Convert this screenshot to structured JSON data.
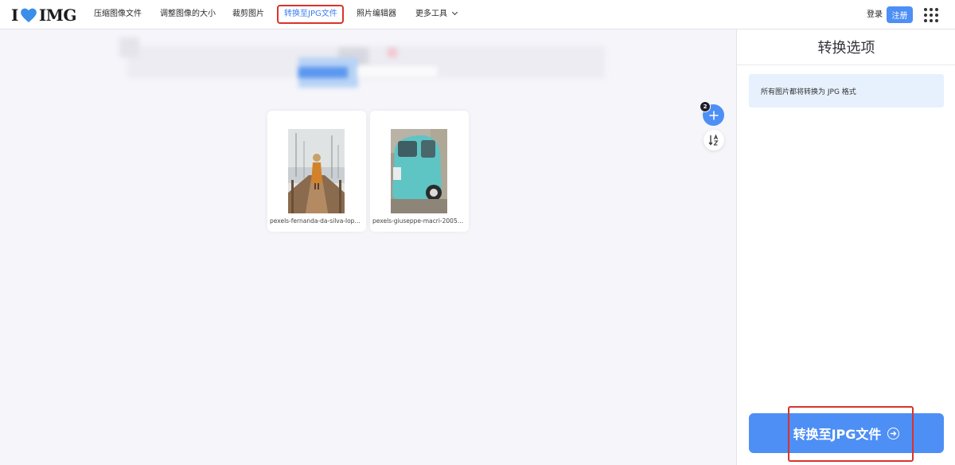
{
  "header": {
    "logo_text_left": "I",
    "logo_text_right": "IMG",
    "nav": [
      {
        "label": "压缩图像文件"
      },
      {
        "label": "调整图像的大小"
      },
      {
        "label": "裁剪图片"
      },
      {
        "label": "转换至JPG文件",
        "active": true
      },
      {
        "label": "照片编辑器"
      },
      {
        "label": "更多工具"
      }
    ],
    "login_label": "登录",
    "signup_label": "注册"
  },
  "files": [
    {
      "name": "pexels-fernanda-da-silva-lopes-..."
    },
    {
      "name": "pexels-giuseppe-macri-2005726..."
    }
  ],
  "file_count": "2",
  "sidebar": {
    "title": "转换选项",
    "info": "所有图片都将转换为 JPG 格式",
    "convert_label": "转换至JPG文件"
  },
  "colors": {
    "accent": "#4d8ff5",
    "highlight_outline": "#d9342b",
    "info_bg": "#e7f1fd"
  },
  "icons": [
    "heart-logo-icon",
    "chevron-down-icon",
    "apps-grid-icon",
    "plus-icon",
    "sort-az-icon",
    "arrow-right-circle-icon"
  ]
}
